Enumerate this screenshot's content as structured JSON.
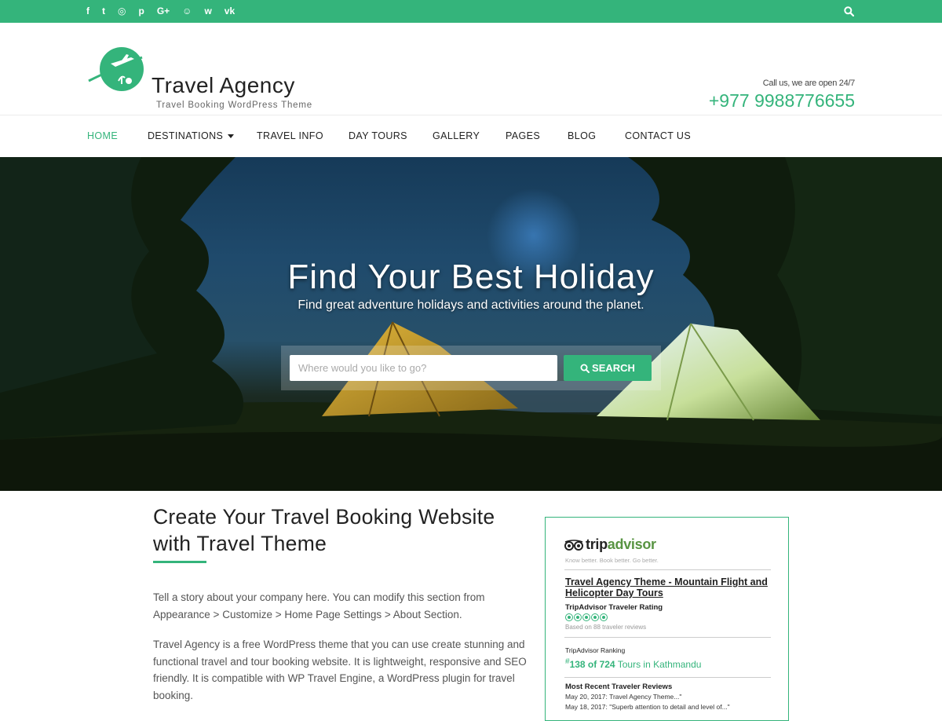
{
  "colors": {
    "accent": "#34b47b",
    "topbar": "#34b47b",
    "text_dark": "#222222"
  },
  "topbar": {
    "social_icons": [
      "facebook-icon",
      "twitter-icon",
      "instagram-icon",
      "pinterest-icon",
      "google-plus-icon",
      "snapchat-icon",
      "weibo-icon",
      "vk-icon"
    ],
    "social_glyphs": [
      "f",
      "t",
      "◎",
      "p",
      "G+",
      "☺",
      "w",
      "vk"
    ]
  },
  "header": {
    "brand_title": "Travel Agency",
    "brand_tagline": "Travel Booking WordPress Theme",
    "call_label": "Call us, we are open 24/7",
    "phone": "+977 9988776655"
  },
  "nav": {
    "items": [
      {
        "label": "HOME",
        "active": true
      },
      {
        "label": "DESTINATIONS",
        "has_dropdown": true
      },
      {
        "label": "TRAVEL INFO"
      },
      {
        "label": "DAY TOURS"
      },
      {
        "label": "GALLERY"
      },
      {
        "label": "PAGES"
      },
      {
        "label": "BLOG"
      },
      {
        "label": "CONTACT US"
      }
    ]
  },
  "hero": {
    "title": "Find Your Best Holiday",
    "subtitle": "Find great adventure holidays and activities around the planet.",
    "search_placeholder": "Where would you like to go?",
    "search_button": "SEARCH"
  },
  "about": {
    "title": "Create Your Travel Booking Website with Travel Theme",
    "p1": "Tell a story about your company here. You can modify this section from Appearance > Customize > Home Page Settings > About Section.",
    "p2": "Travel Agency is a free WordPress theme that you can use create stunning and functional travel and tour booking website. It is lightweight, responsive and SEO friendly. It is compatible with WP Travel Engine, a WordPress plugin for travel booking."
  },
  "tripadvisor": {
    "logo_trip": "trip",
    "logo_advisor": "advisor",
    "tagline": "Know better. Book better. Go better.",
    "listing_link": "Travel Agency Theme - Mountain Flight and Helicopter Day Tours",
    "rating_label": "TripAdvisor Traveler Rating",
    "rating_value": 5,
    "rating_count": "Based on 88 traveler reviews",
    "ranking_label": "TripAdvisor Ranking",
    "ranking_hash": "#",
    "ranking_text": "138 of 724",
    "ranking_suffix": " Tours in Kathmandu",
    "reviews_label": "Most Recent Traveler Reviews",
    "reviews": [
      "May 20, 2017: Travel Agency Theme...\"",
      "May 18, 2017: \"Superb attention to detail and level of...\""
    ]
  }
}
